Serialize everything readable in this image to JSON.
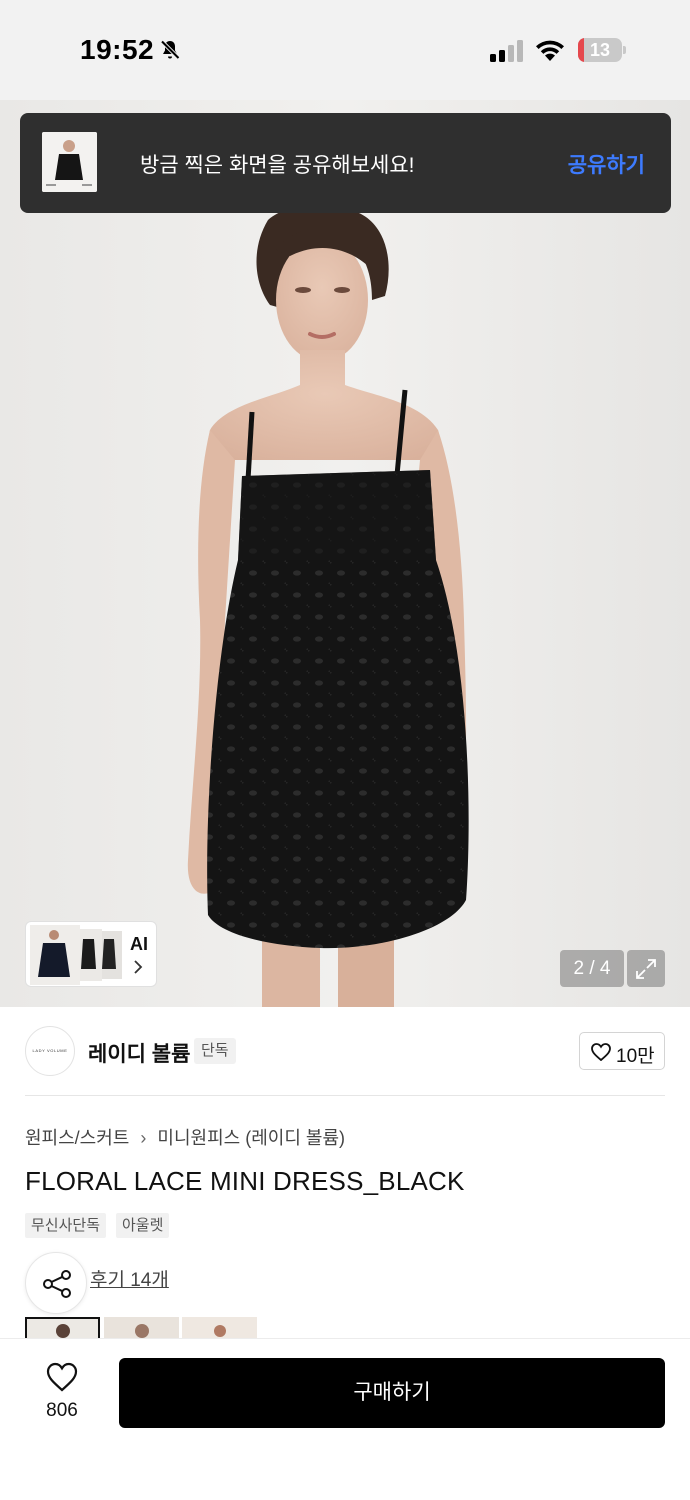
{
  "status_bar": {
    "time": "19:52",
    "battery_level": "13",
    "battery_fraction": 0.13,
    "icons": [
      "bell-slash-icon",
      "cellular-signal-icon",
      "wifi-icon",
      "battery-icon"
    ]
  },
  "share_toast": {
    "message": "방금 찍은 화면을 공유해보세요!",
    "action_label": "공유하기",
    "action_color": "#3d7bff"
  },
  "gallery": {
    "ai_label": "AI",
    "current_page": 2,
    "total_pages": 4,
    "page_indicator": "2 / 4"
  },
  "brand": {
    "name": "레이디 볼륨",
    "logo_text": "LADY VOLUME",
    "badge": "단독",
    "like_count": "10만"
  },
  "product": {
    "breadcrumb": [
      "원피스/스커트",
      "미니원피스 (레이디 볼륨)"
    ],
    "title": "FLORAL LACE MINI DRESS_BLACK",
    "tags": [
      "무신사단독",
      "아울렛"
    ],
    "review_link": "후기 14개"
  },
  "bottom_bar": {
    "wish_count": "806",
    "buy_label": "구매하기",
    "buy_color": "#000000"
  }
}
